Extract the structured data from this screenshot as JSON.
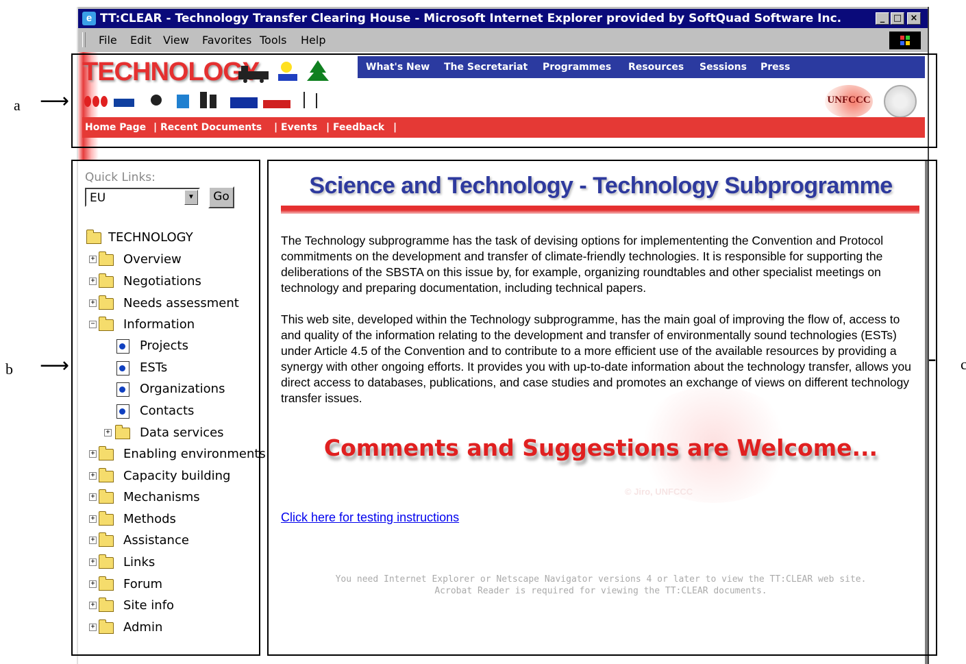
{
  "annotations": {
    "a": "a",
    "b": "b",
    "c": "c"
  },
  "window": {
    "title": "TT:CLEAR - Technology Transfer Clearing House - Microsoft Internet Explorer provided by SoftQuad Software Inc.",
    "controls": {
      "minimize": "_",
      "maximize": "□",
      "close": "×"
    },
    "menu": [
      "File",
      "Edit",
      "View",
      "Favorites",
      "Tools",
      "Help"
    ]
  },
  "header": {
    "logo": "TECHNOLOGY",
    "nav": [
      "What's New",
      "The Secretariat",
      "Programmes",
      "Resources",
      "Sessions",
      "Press"
    ],
    "org_logo": "UNFCCC",
    "bottom_nav": [
      "Home Page",
      "Recent Documents",
      "Events",
      "Feedback"
    ],
    "separator": "|"
  },
  "sidebar": {
    "quick_links_label": "Quick Links:",
    "quick_links_value": "EU",
    "go_label": "Go",
    "tree": [
      {
        "label": "TECHNOLOGY",
        "type": "root"
      },
      {
        "label": "Overview",
        "type": "folder",
        "expander": "+"
      },
      {
        "label": "Negotiations",
        "type": "folder",
        "expander": "+"
      },
      {
        "label": "Needs assessment",
        "type": "folder",
        "expander": "+"
      },
      {
        "label": "Information",
        "type": "folder",
        "expander": "−"
      },
      {
        "label": "Projects",
        "type": "doc"
      },
      {
        "label": "ESTs",
        "type": "doc"
      },
      {
        "label": "Organizations",
        "type": "doc"
      },
      {
        "label": "Contacts",
        "type": "doc"
      },
      {
        "label": "Data services",
        "type": "subfolder",
        "expander": "+"
      },
      {
        "label": "Enabling environments",
        "type": "folder",
        "expander": "+"
      },
      {
        "label": "Capacity building",
        "type": "folder",
        "expander": "+"
      },
      {
        "label": "Mechanisms",
        "type": "folder",
        "expander": "+"
      },
      {
        "label": "Methods",
        "type": "folder",
        "expander": "+"
      },
      {
        "label": "Assistance",
        "type": "folder",
        "expander": "+"
      },
      {
        "label": "Links",
        "type": "folder",
        "expander": "+"
      },
      {
        "label": "Forum",
        "type": "folder",
        "expander": "+"
      },
      {
        "label": "Site info",
        "type": "folder",
        "expander": "+"
      },
      {
        "label": "Admin",
        "type": "folder",
        "expander": "+"
      }
    ]
  },
  "main": {
    "title": "Science and Technology - Technology Subprogramme",
    "paragraph1": "The Technology subprogramme has the task of devising options for implemententing the Convention and Protocol commitments on the  development and transfer of climate-friendly technologies. It is  responsible for supporting the deliberations of the SBSTA on this issue by, for example, organizing roundtables and other specialist meetings on technology and preparing documentation, including technical papers.",
    "paragraph2": "This web site, developed within the Technology subprogramme, has the main goal of improving the flow of, access to and quality of the information relating to the development and transfer of environmentally sound technologies (ESTs) under Article 4.5 of the Convention and to contribute to a more efficient use of the available resources by providing a synergy with other ongoing efforts. It provides you with up-to-date information about the technology transfer, allows you direct access to databases, publications, and case studies and promotes an exchange of views on different technology transfer issues.",
    "comments": "Comments and Suggestions are Welcome...",
    "watermark": "© Jiro, UNFCCC",
    "testing_link": "Click here for testing instructions",
    "footnote1": "You need Internet Explorer or Netscape Navigator versions 4 or later to view the TT:CLEAR web site.",
    "footnote2": "Acrobat Reader is required for viewing the TT:CLEAR documents."
  }
}
